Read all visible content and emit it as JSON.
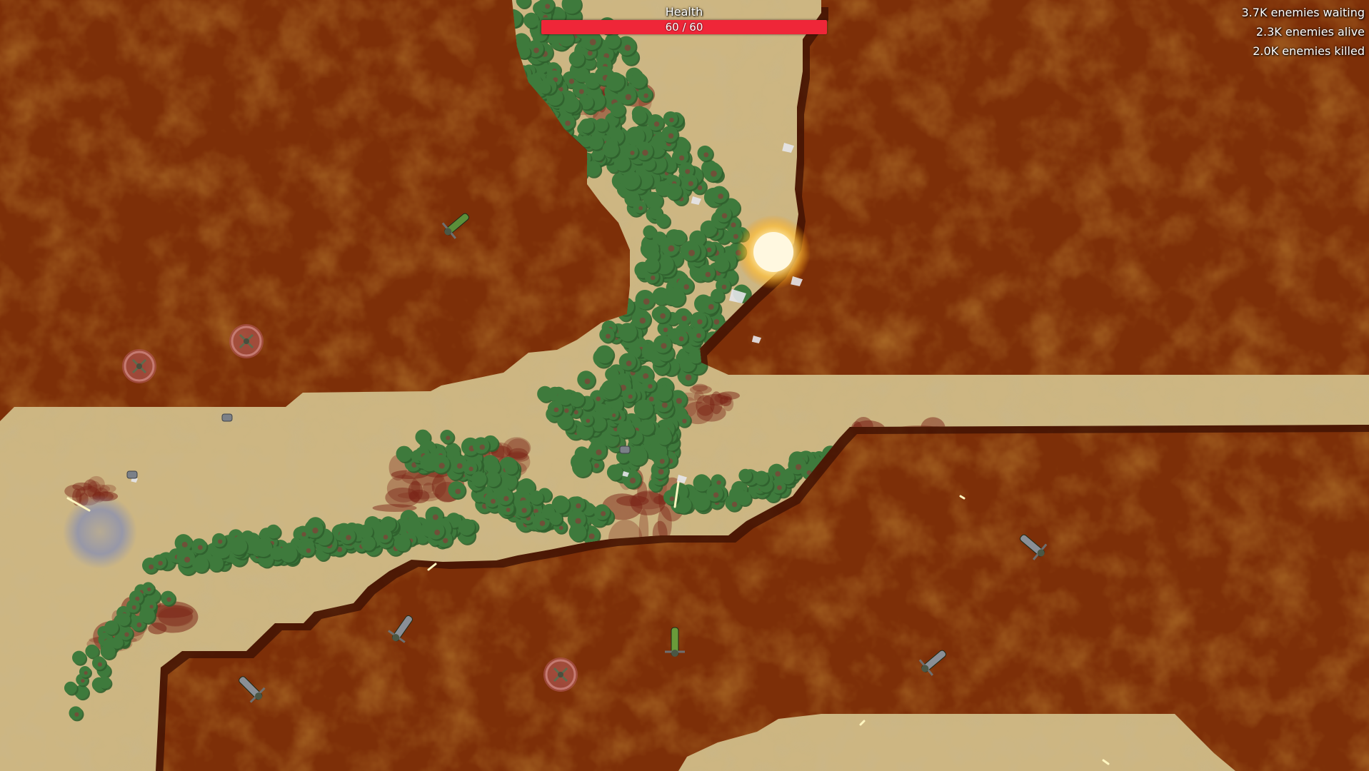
{
  "hud": {
    "health": {
      "label": "Health",
      "current": 60,
      "max": 60,
      "text": "60 / 60",
      "fill_fraction": 1.0
    },
    "stats": [
      {
        "text": "3.7K enemies waiting"
      },
      {
        "text": "2.3K enemies alive"
      },
      {
        "text": "2.0K enemies killed"
      }
    ]
  },
  "colors": {
    "ground": "#7d2f08",
    "sand": "#cdb682",
    "foliage": "#3e7a3c",
    "foliage_dark": "#2f5f2c",
    "blood": "#7a2316",
    "health_fill": "#ef2638",
    "health_bg": "#5a0f14",
    "text": "#ffffff"
  }
}
